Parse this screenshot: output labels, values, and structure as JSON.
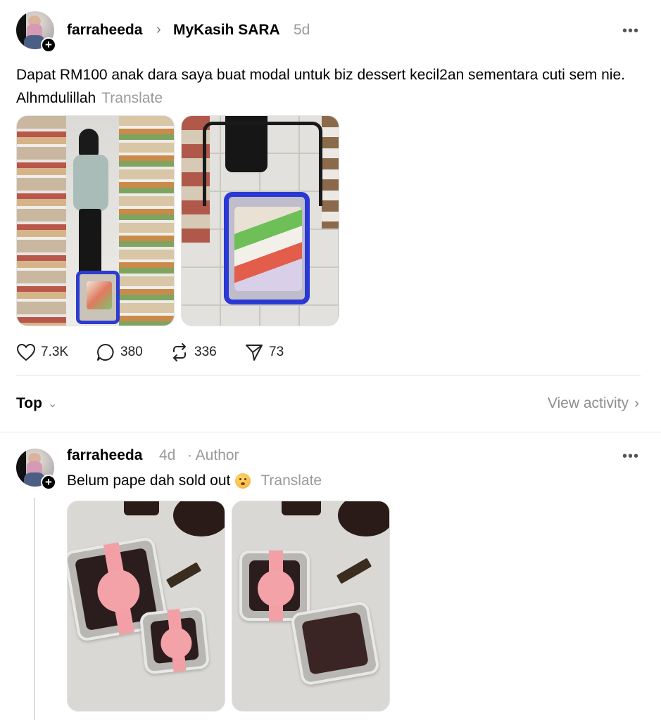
{
  "post": {
    "username": "farraheeda",
    "topic": "MyKasih SARA",
    "age": "5d",
    "text": "Dapat RM100 anak dara saya buat modal untuk biz dessert kecil2an sementara cuti sem nie. Alhmdulillah",
    "translate": "Translate",
    "more": "•••",
    "stats": {
      "likes": "7.3K",
      "comments": "380",
      "reposts": "336",
      "shares": "73"
    }
  },
  "sort": {
    "label": "Top",
    "view_activity": "View activity"
  },
  "reply": {
    "username": "farraheeda",
    "age": "4d",
    "author_tag": "· Author",
    "text": "Belum pape dah sold out",
    "translate": "Translate",
    "more": "•••"
  },
  "icons": {
    "like": "heart-icon",
    "comment": "comment-bubble-icon",
    "repost": "repost-icon",
    "share": "send-icon",
    "add": "plus-icon"
  },
  "colors": {
    "muted": "#9a9a9a",
    "text": "#000000",
    "divider": "#e3e3e3"
  }
}
